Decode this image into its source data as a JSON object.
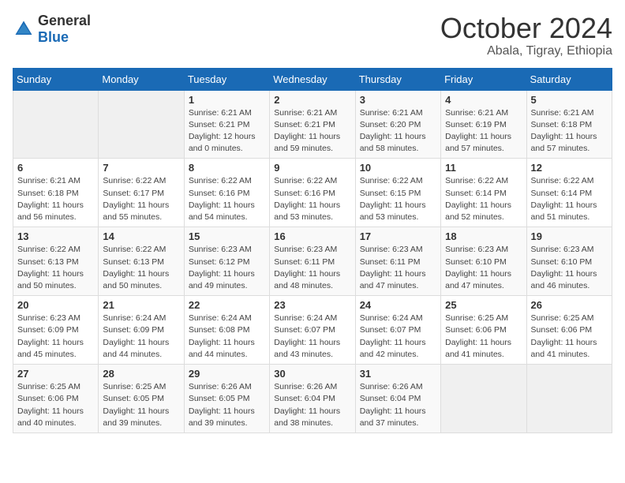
{
  "header": {
    "logo": {
      "general": "General",
      "blue": "Blue"
    },
    "month": "October 2024",
    "location": "Abala, Tigray, Ethiopia"
  },
  "weekdays": [
    "Sunday",
    "Monday",
    "Tuesday",
    "Wednesday",
    "Thursday",
    "Friday",
    "Saturday"
  ],
  "weeks": [
    [
      {
        "day": "",
        "info": ""
      },
      {
        "day": "",
        "info": ""
      },
      {
        "day": "1",
        "info": "Sunrise: 6:21 AM\nSunset: 6:21 PM\nDaylight: 12 hours and 0 minutes."
      },
      {
        "day": "2",
        "info": "Sunrise: 6:21 AM\nSunset: 6:21 PM\nDaylight: 11 hours and 59 minutes."
      },
      {
        "day": "3",
        "info": "Sunrise: 6:21 AM\nSunset: 6:20 PM\nDaylight: 11 hours and 58 minutes."
      },
      {
        "day": "4",
        "info": "Sunrise: 6:21 AM\nSunset: 6:19 PM\nDaylight: 11 hours and 57 minutes."
      },
      {
        "day": "5",
        "info": "Sunrise: 6:21 AM\nSunset: 6:18 PM\nDaylight: 11 hours and 57 minutes."
      }
    ],
    [
      {
        "day": "6",
        "info": "Sunrise: 6:21 AM\nSunset: 6:18 PM\nDaylight: 11 hours and 56 minutes."
      },
      {
        "day": "7",
        "info": "Sunrise: 6:22 AM\nSunset: 6:17 PM\nDaylight: 11 hours and 55 minutes."
      },
      {
        "day": "8",
        "info": "Sunrise: 6:22 AM\nSunset: 6:16 PM\nDaylight: 11 hours and 54 minutes."
      },
      {
        "day": "9",
        "info": "Sunrise: 6:22 AM\nSunset: 6:16 PM\nDaylight: 11 hours and 53 minutes."
      },
      {
        "day": "10",
        "info": "Sunrise: 6:22 AM\nSunset: 6:15 PM\nDaylight: 11 hours and 53 minutes."
      },
      {
        "day": "11",
        "info": "Sunrise: 6:22 AM\nSunset: 6:14 PM\nDaylight: 11 hours and 52 minutes."
      },
      {
        "day": "12",
        "info": "Sunrise: 6:22 AM\nSunset: 6:14 PM\nDaylight: 11 hours and 51 minutes."
      }
    ],
    [
      {
        "day": "13",
        "info": "Sunrise: 6:22 AM\nSunset: 6:13 PM\nDaylight: 11 hours and 50 minutes."
      },
      {
        "day": "14",
        "info": "Sunrise: 6:22 AM\nSunset: 6:13 PM\nDaylight: 11 hours and 50 minutes."
      },
      {
        "day": "15",
        "info": "Sunrise: 6:23 AM\nSunset: 6:12 PM\nDaylight: 11 hours and 49 minutes."
      },
      {
        "day": "16",
        "info": "Sunrise: 6:23 AM\nSunset: 6:11 PM\nDaylight: 11 hours and 48 minutes."
      },
      {
        "day": "17",
        "info": "Sunrise: 6:23 AM\nSunset: 6:11 PM\nDaylight: 11 hours and 47 minutes."
      },
      {
        "day": "18",
        "info": "Sunrise: 6:23 AM\nSunset: 6:10 PM\nDaylight: 11 hours and 47 minutes."
      },
      {
        "day": "19",
        "info": "Sunrise: 6:23 AM\nSunset: 6:10 PM\nDaylight: 11 hours and 46 minutes."
      }
    ],
    [
      {
        "day": "20",
        "info": "Sunrise: 6:23 AM\nSunset: 6:09 PM\nDaylight: 11 hours and 45 minutes."
      },
      {
        "day": "21",
        "info": "Sunrise: 6:24 AM\nSunset: 6:09 PM\nDaylight: 11 hours and 44 minutes."
      },
      {
        "day": "22",
        "info": "Sunrise: 6:24 AM\nSunset: 6:08 PM\nDaylight: 11 hours and 44 minutes."
      },
      {
        "day": "23",
        "info": "Sunrise: 6:24 AM\nSunset: 6:07 PM\nDaylight: 11 hours and 43 minutes."
      },
      {
        "day": "24",
        "info": "Sunrise: 6:24 AM\nSunset: 6:07 PM\nDaylight: 11 hours and 42 minutes."
      },
      {
        "day": "25",
        "info": "Sunrise: 6:25 AM\nSunset: 6:06 PM\nDaylight: 11 hours and 41 minutes."
      },
      {
        "day": "26",
        "info": "Sunrise: 6:25 AM\nSunset: 6:06 PM\nDaylight: 11 hours and 41 minutes."
      }
    ],
    [
      {
        "day": "27",
        "info": "Sunrise: 6:25 AM\nSunset: 6:06 PM\nDaylight: 11 hours and 40 minutes."
      },
      {
        "day": "28",
        "info": "Sunrise: 6:25 AM\nSunset: 6:05 PM\nDaylight: 11 hours and 39 minutes."
      },
      {
        "day": "29",
        "info": "Sunrise: 6:26 AM\nSunset: 6:05 PM\nDaylight: 11 hours and 39 minutes."
      },
      {
        "day": "30",
        "info": "Sunrise: 6:26 AM\nSunset: 6:04 PM\nDaylight: 11 hours and 38 minutes."
      },
      {
        "day": "31",
        "info": "Sunrise: 6:26 AM\nSunset: 6:04 PM\nDaylight: 11 hours and 37 minutes."
      },
      {
        "day": "",
        "info": ""
      },
      {
        "day": "",
        "info": ""
      }
    ]
  ]
}
